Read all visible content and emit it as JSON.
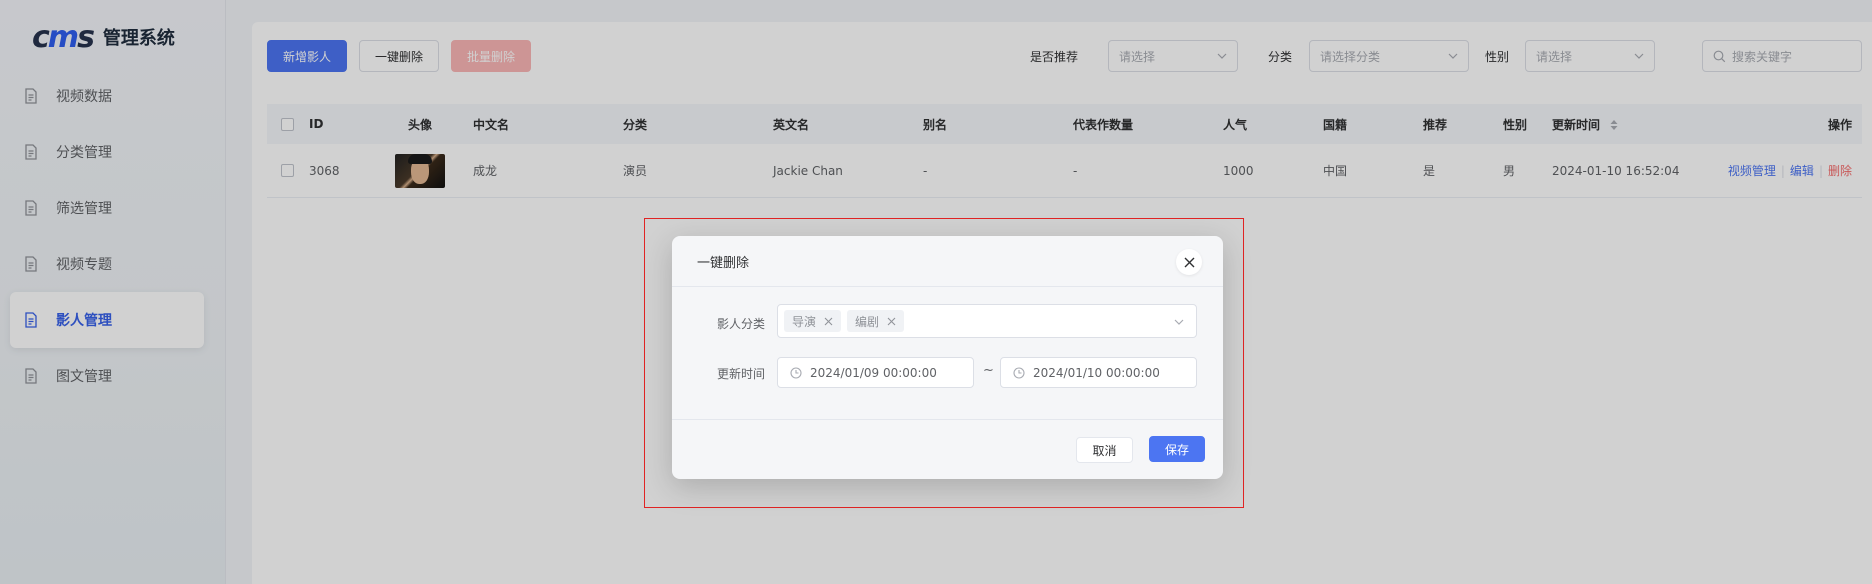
{
  "app": {
    "logo_mark": "cms",
    "logo_m": "m",
    "logo_text": "管理系统"
  },
  "sidebar": {
    "items": [
      {
        "label": "视频数据"
      },
      {
        "label": "分类管理"
      },
      {
        "label": "筛选管理"
      },
      {
        "label": "视频专题"
      },
      {
        "label": "影人管理",
        "active": true
      },
      {
        "label": "图文管理"
      }
    ]
  },
  "toolbar": {
    "add_label": "新增影人",
    "one_click_delete_label": "一键删除",
    "batch_delete_label": "批量删除",
    "recommend_label": "是否推荐",
    "recommend_placeholder": "请选择",
    "category_label": "分类",
    "category_placeholder": "请选择分类",
    "gender_label": "性别",
    "gender_placeholder": "请选择",
    "search_placeholder": "搜索关键字"
  },
  "table": {
    "headers": {
      "id": "ID",
      "avatar": "头像",
      "cn_name": "中文名",
      "category": "分类",
      "en_name": "英文名",
      "alias": "别名",
      "works": "代表作数量",
      "popularity": "人气",
      "nationality": "国籍",
      "recommend": "推荐",
      "gender": "性别",
      "updated": "更新时间",
      "actions": "操作"
    },
    "rows": [
      {
        "id": "3068",
        "cn_name": "成龙",
        "category": "演员",
        "en_name": "Jackie Chan",
        "alias": "-",
        "works": "-",
        "popularity": "1000",
        "nationality": "中国",
        "recommend": "是",
        "gender": "男",
        "updated": "2024-01-10 16:52:04",
        "action_video": "视频管理",
        "action_edit": "编辑",
        "action_delete": "删除"
      }
    ]
  },
  "dialog": {
    "title": "一键删除",
    "category_label": "影人分类",
    "tags": [
      "导演",
      "编剧"
    ],
    "time_label": "更新时间",
    "start_time": "2024/01/09 00:00:00",
    "end_time": "2024/01/10 00:00:00",
    "range_separator": "~",
    "cancel_label": "取消",
    "save_label": "保存"
  },
  "colors": {
    "primary": "#4c75f2",
    "danger": "#f56c6c",
    "highlight": "#e02424"
  }
}
